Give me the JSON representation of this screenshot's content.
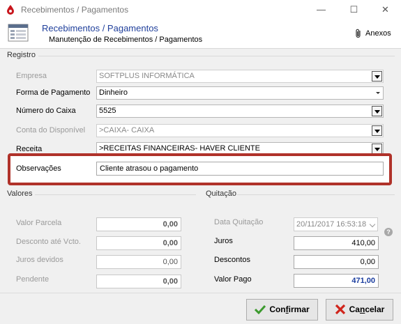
{
  "window": {
    "title": "Recebimentos / Pagamentos",
    "controls": {
      "minimize": "—",
      "maximize": "☐",
      "close": "✕"
    }
  },
  "header": {
    "title": "Recebimentos / Pagamentos",
    "subtitle": "Manutenção de Recebimentos / Pagamentos",
    "anexos": "Anexos"
  },
  "registro": {
    "legend": "Registro",
    "empresa": {
      "label": "Empresa",
      "value": "SOFTPLUS INFORMÁTICA"
    },
    "forma_pagamento": {
      "label": "Forma de Pagamento",
      "value": "Dinheiro"
    },
    "numero_caixa": {
      "label": "Número do Caixa",
      "value": "5525"
    },
    "conta_disponivel": {
      "label": "Conta do Disponível",
      "value": ">CAIXA- CAIXA"
    },
    "receita": {
      "label": "Receita",
      "value": ">RECEITAS FINANCEIRAS- HAVER CLIENTE"
    },
    "observacoes": {
      "label": "Observações",
      "value": "Cliente atrasou o pagamento"
    }
  },
  "valores": {
    "legend": "Valores",
    "valor_parcela": {
      "label": "Valor Parcela",
      "value": "0,00"
    },
    "desconto_vcto": {
      "label": "Desconto até Vcto.",
      "value": "0,00"
    },
    "juros_devidos": {
      "label": "Juros devidos",
      "value": "0,00"
    },
    "pendente": {
      "label": "Pendente",
      "value": "0,00"
    }
  },
  "quitacao": {
    "legend": "Quitação",
    "data_quitacao": {
      "label": "Data Quitação",
      "value": "20/11/2017 16:53:18"
    },
    "juros": {
      "label": "Juros",
      "value": "410,00"
    },
    "descontos": {
      "label": "Descontos",
      "value": "0,00"
    },
    "valor_pago": {
      "label": "Valor Pago",
      "value": "471,00"
    },
    "help": "?"
  },
  "footer": {
    "confirmar": {
      "prefix": "Con",
      "hotkey": "f",
      "suffix": "irmar"
    },
    "cancelar": {
      "prefix": "Ca",
      "hotkey": "n",
      "suffix": "celar"
    }
  },
  "colors": {
    "accent": "#1f3f9b",
    "highlight": "#b0322a",
    "valor_pago": "#1a3c9e"
  }
}
